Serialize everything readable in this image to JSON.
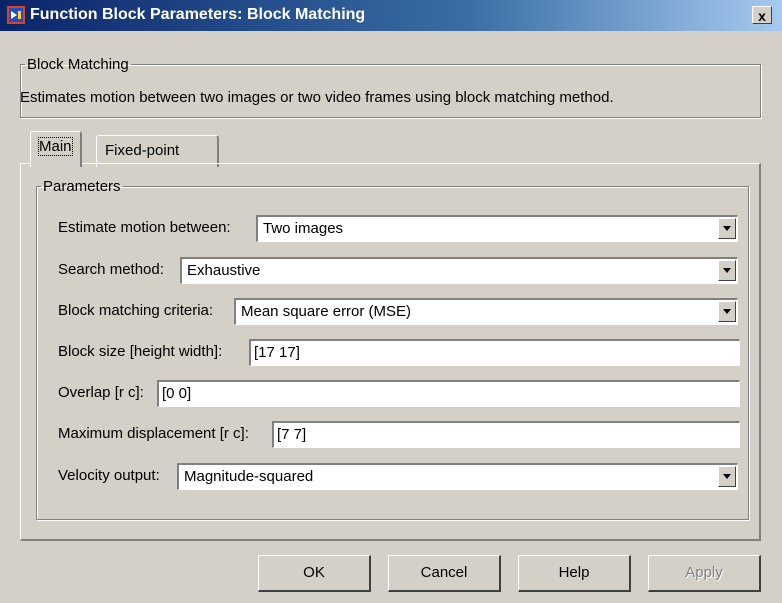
{
  "window": {
    "title": "Function Block Parameters: Block Matching",
    "close_label": "x"
  },
  "block": {
    "group_label": "Block Matching",
    "description": "Estimates motion between two images or two video frames using block matching method."
  },
  "tabs": [
    {
      "label": "Main",
      "active": true
    },
    {
      "label": "Fixed-point",
      "active": false
    }
  ],
  "parameters": {
    "group_label": "Parameters",
    "estimate_motion": {
      "label": "Estimate motion between:",
      "value": "Two images"
    },
    "search_method": {
      "label": "Search method:",
      "value": "Exhaustive"
    },
    "criteria": {
      "label": "Block matching criteria:",
      "value": "Mean square error (MSE)"
    },
    "block_size": {
      "label": "Block size [height width]:",
      "value": "[17 17]"
    },
    "overlap": {
      "label": "Overlap [r c]:",
      "value": "[0 0]"
    },
    "max_displacement": {
      "label": "Maximum displacement [r c]:",
      "value": "[7 7]"
    },
    "velocity_output": {
      "label": "Velocity output:",
      "value": "Magnitude-squared"
    }
  },
  "buttons": {
    "ok": "OK",
    "cancel": "Cancel",
    "help": "Help",
    "apply": "Apply"
  },
  "colors": {
    "titlebar_start": "#0a246a",
    "titlebar_end": "#a6caf0",
    "face": "#d4d0c8"
  }
}
